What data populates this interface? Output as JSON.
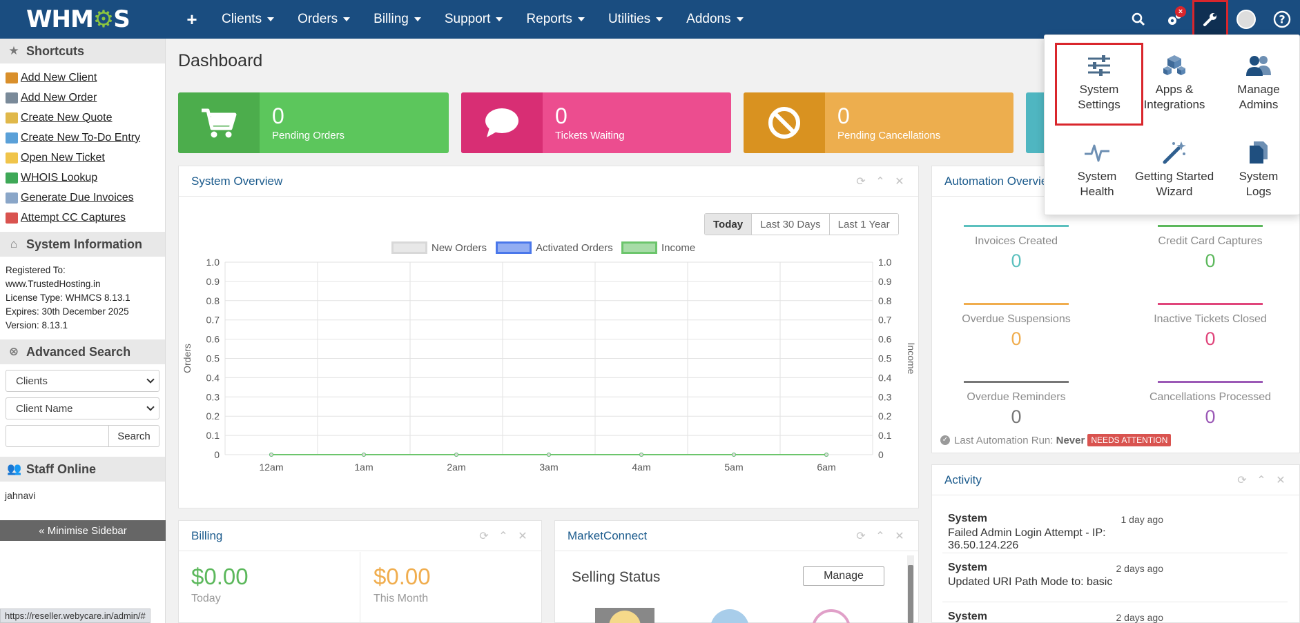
{
  "nav": {
    "logo": "WHMCS",
    "items": [
      "Clients",
      "Orders",
      "Billing",
      "Support",
      "Reports",
      "Utilities",
      "Addons"
    ],
    "notification_badge": "×"
  },
  "sidebar": {
    "shortcuts_title": "Shortcuts",
    "shortcuts": [
      {
        "label": "Add New Client",
        "color": "#d98f2b"
      },
      {
        "label": "Add New Order",
        "color": "#7a8a99"
      },
      {
        "label": "Create New Quote",
        "color": "#e0b84a"
      },
      {
        "label": "Create New To-Do Entry",
        "color": "#5aa0d8"
      },
      {
        "label": "Open New Ticket",
        "color": "#f0c44a"
      },
      {
        "label": "WHOIS Lookup",
        "color": "#3ea857"
      },
      {
        "label": "Generate Due Invoices",
        "color": "#8aa6c8"
      },
      {
        "label": "Attempt CC Captures",
        "color": "#d9534f"
      }
    ],
    "sysinfo_title": "System Information",
    "sysinfo": [
      "Registered To:",
      "www.TrustedHosting.in",
      "License Type: WHMCS 8.13.1",
      "Expires: 30th December 2025",
      "Version: 8.13.1"
    ],
    "advsearch_title": "Advanced Search",
    "search_type": "Clients",
    "search_field": "Client Name",
    "search_button": "Search",
    "staff_title": "Staff Online",
    "staff": "jahnavi",
    "minimise": "« Minimise Sidebar"
  },
  "status_url": "https://reseller.webycare.in/admin/#",
  "page_title": "Dashboard",
  "stats": [
    {
      "value": "0",
      "label": "Pending Orders",
      "color": "#5cc65c",
      "icon_bg": "#4cad4c"
    },
    {
      "value": "0",
      "label": "Tickets Waiting",
      "color": "#ec4d8f",
      "icon_bg": "#d82e74"
    },
    {
      "value": "0",
      "label": "Pending Cancellations",
      "color": "#edae4e",
      "icon_bg": "#d99220"
    }
  ],
  "system_overview": {
    "title": "System Overview",
    "ranges": [
      "Today",
      "Last 30 Days",
      "Last 1 Year"
    ],
    "active_range": "Today",
    "legend": [
      {
        "name": "New Orders",
        "color": "#d8d8d8"
      },
      {
        "name": "Activated Orders",
        "color": "#4a77ea"
      },
      {
        "name": "Income",
        "color": "#6cc56c"
      }
    ],
    "ylabel_left": "Orders",
    "ylabel_right": "Income"
  },
  "chart_data": {
    "type": "line",
    "categories": [
      "12am",
      "1am",
      "2am",
      "3am",
      "4am",
      "5am",
      "6am"
    ],
    "series": [
      {
        "name": "New Orders",
        "values": [
          0,
          0,
          0,
          0,
          0,
          0,
          0
        ]
      },
      {
        "name": "Activated Orders",
        "values": [
          0,
          0,
          0,
          0,
          0,
          0,
          0
        ]
      },
      {
        "name": "Income",
        "values": [
          0,
          0,
          0,
          0,
          0,
          0,
          0
        ]
      }
    ],
    "yticks": [
      "0",
      "0.1",
      "0.2",
      "0.3",
      "0.4",
      "0.5",
      "0.6",
      "0.7",
      "0.8",
      "0.9",
      "1.0"
    ],
    "ylim": [
      0,
      1
    ],
    "xlabel": "",
    "ylabel": "Orders",
    "y2label": "Income",
    "grid": true,
    "legend": "top"
  },
  "automation": {
    "title": "Automation Overview",
    "cells": [
      {
        "label": "Invoices Created",
        "value": "0",
        "color": "#5bc0be"
      },
      {
        "label": "Credit Card Captures",
        "value": "0",
        "color": "#5cb85c"
      },
      {
        "label": "Overdue Suspensions",
        "value": "0",
        "color": "#f0ad4e"
      },
      {
        "label": "Inactive Tickets Closed",
        "value": "0",
        "color": "#e0457b"
      },
      {
        "label": "Overdue Reminders",
        "value": "0",
        "color": "#777777"
      },
      {
        "label": "Cancellations Processed",
        "value": "0",
        "color": "#9b59b6"
      }
    ],
    "last_run_label": "Last Automation Run:",
    "last_run_value": "Never",
    "needs_attention": "NEEDS ATTENTION"
  },
  "activity": {
    "title": "Activity",
    "items": [
      {
        "who": "System",
        "when": "1 day ago",
        "what": "Failed Admin Login Attempt - IP: 36.50.124.226"
      },
      {
        "who": "System",
        "when": "2 days ago",
        "what": "Updated URI Path Mode to: basic"
      },
      {
        "who": "System",
        "when": "2 days ago",
        "what": ""
      }
    ]
  },
  "billing": {
    "title": "Billing",
    "today_amount": "$0.00",
    "today_label": "Today",
    "month_amount": "$0.00",
    "month_label": "This Month"
  },
  "marketconnect": {
    "title": "MarketConnect",
    "selling_status": "Selling Status",
    "manage": "Manage"
  },
  "config_menu": {
    "items": [
      {
        "label1": "System",
        "label2": "Settings"
      },
      {
        "label1": "Apps &",
        "label2": "Integrations"
      },
      {
        "label1": "Manage",
        "label2": "Admins"
      },
      {
        "label1": "System",
        "label2": "Health"
      },
      {
        "label1": "Getting Started",
        "label2": "Wizard"
      },
      {
        "label1": "System",
        "label2": "Logs"
      }
    ]
  }
}
